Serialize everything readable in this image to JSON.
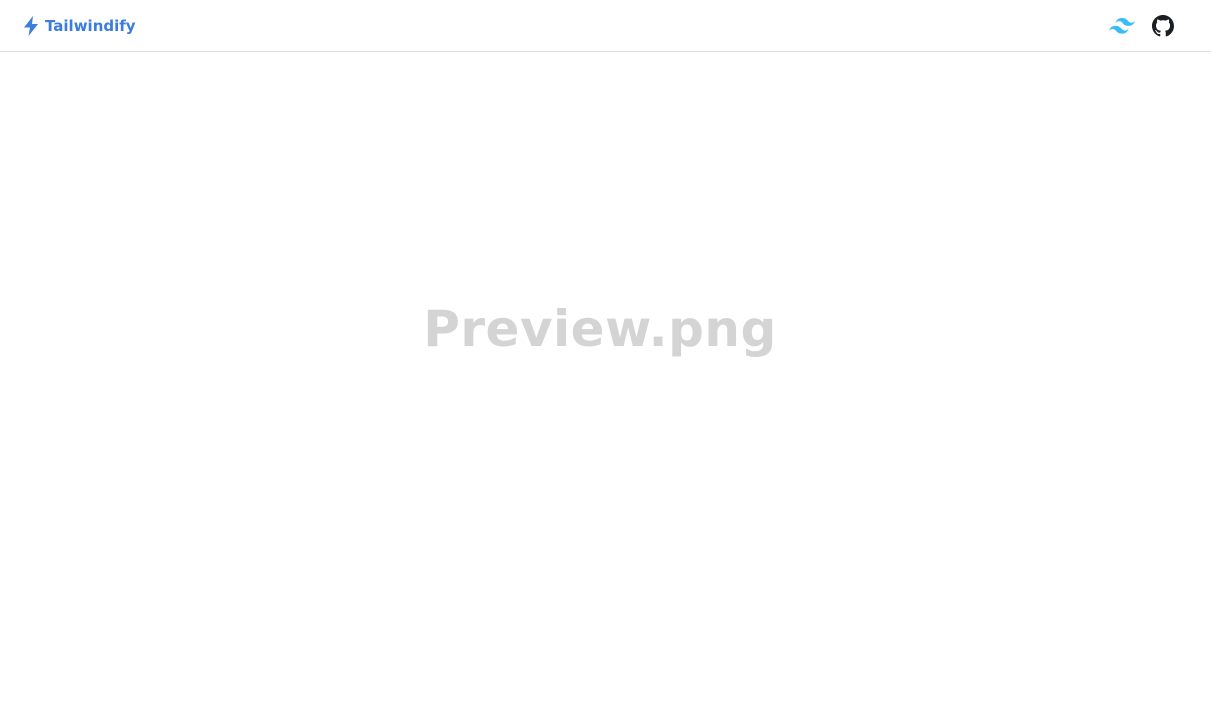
{
  "header": {
    "brand_label": "Tailwindify",
    "brand_icon": "lightning-bolt-icon",
    "links": [
      {
        "icon": "tailwind-logo-icon",
        "color": "#38bdf8"
      },
      {
        "icon": "github-icon",
        "color": "#1b1f23"
      }
    ]
  },
  "main": {
    "placeholder_text": "Preview.png"
  },
  "colors": {
    "brand": "#3b7ddd",
    "border": "#d9e3e8",
    "placeholder": "#d4d4d4"
  }
}
